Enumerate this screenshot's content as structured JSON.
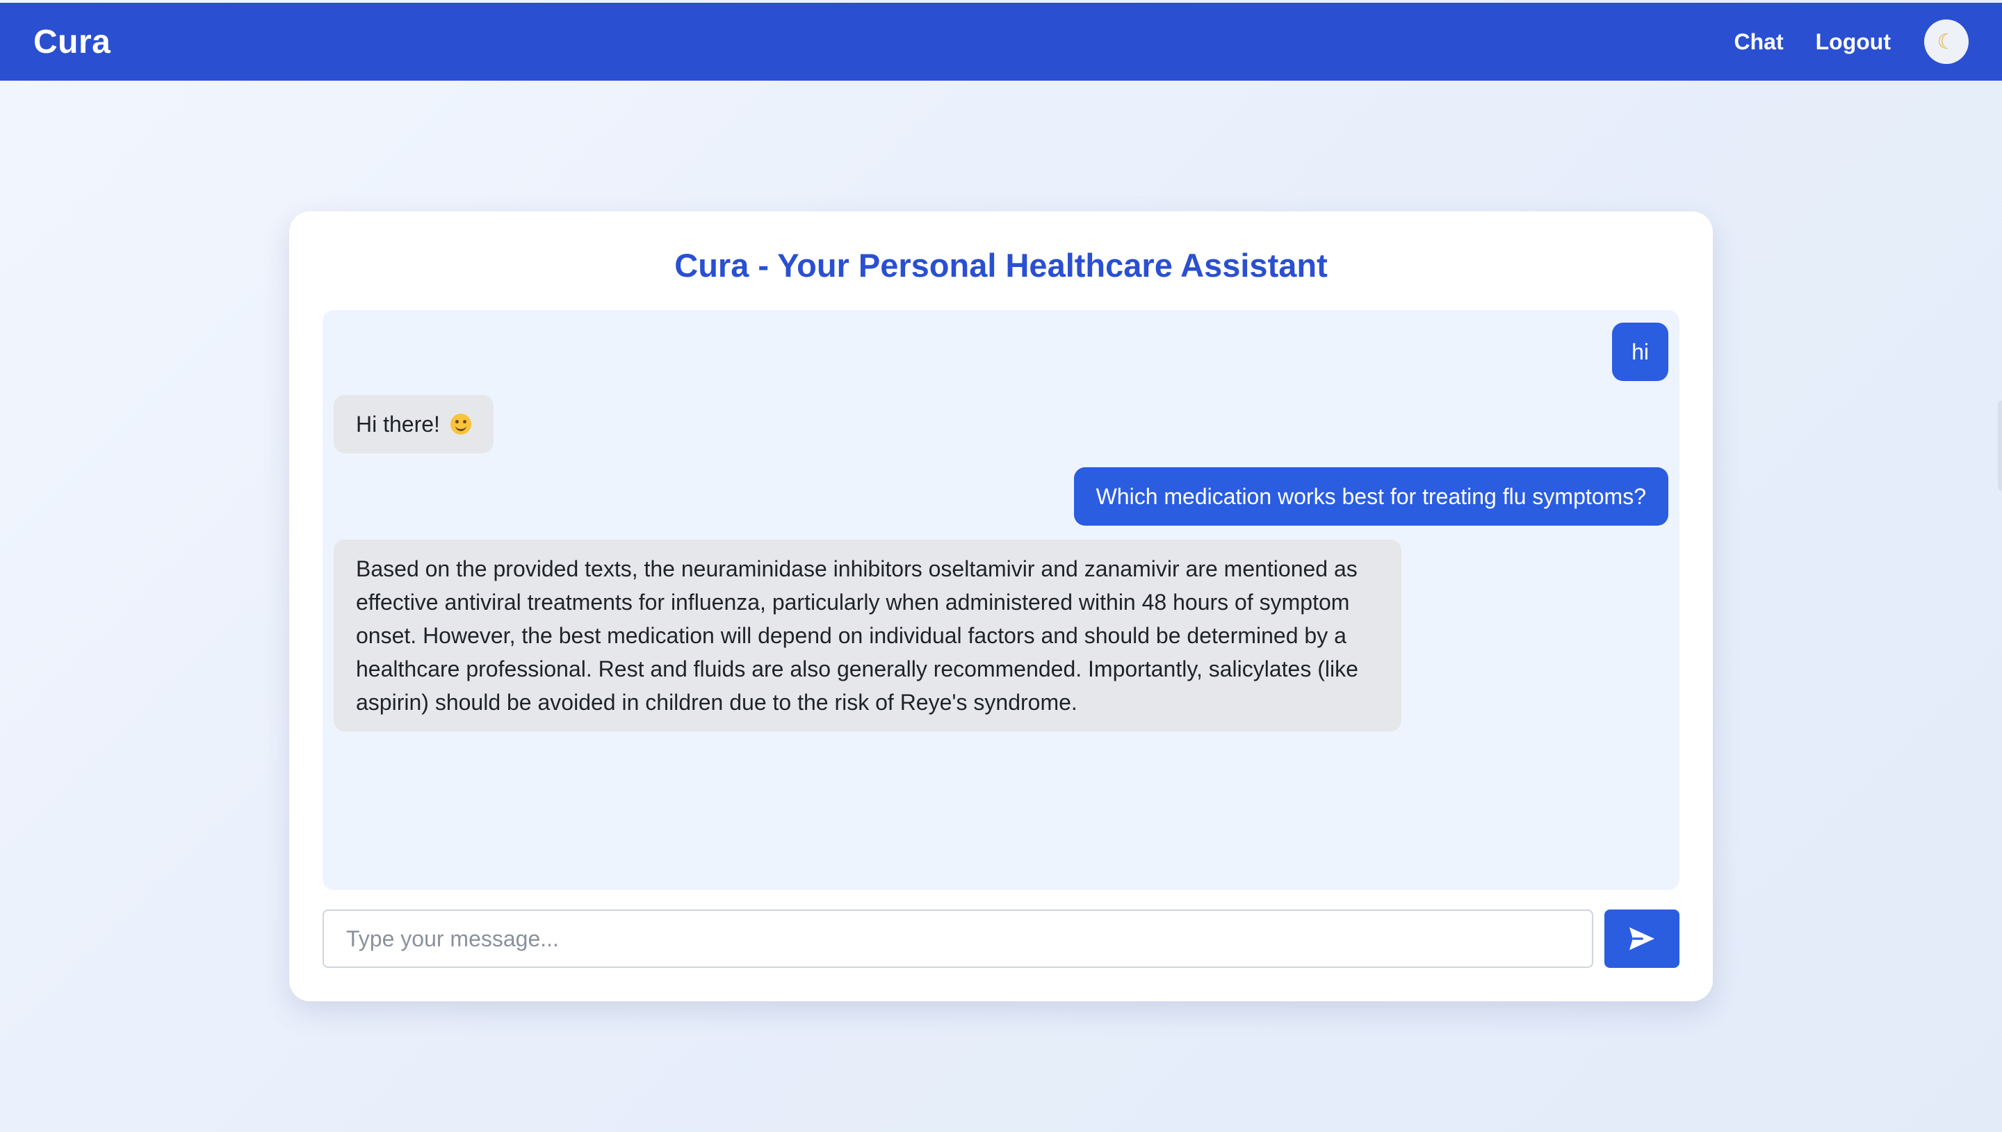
{
  "app": {
    "brand": "Cura"
  },
  "nav": {
    "chat": "Chat",
    "logout": "Logout",
    "theme_icon": "moon-icon"
  },
  "chat": {
    "title": "Cura - Your Personal Healthcare Assistant",
    "messages": [
      {
        "role": "user",
        "text": "hi"
      },
      {
        "role": "assistant",
        "text": "Hi there!",
        "emoji": "smiling-face-icon"
      },
      {
        "role": "user",
        "text": "Which medication works best for treating flu symptoms?"
      },
      {
        "role": "assistant",
        "text": "Based on the provided texts, the neuraminidase inhibitors oseltamivir and zanamivir are mentioned as effective antiviral treatments for influenza, particularly when administered within 48 hours of symptom onset. However, the best medication will depend on individual factors and should be determined by a healthcare professional. Rest and fluids are also generally recommended. Importantly, salicylates (like aspirin) should be avoided in children due to the risk of Reye's syndrome."
      }
    ],
    "input": {
      "value": "",
      "placeholder": "Type your message..."
    },
    "send_icon": "send-icon"
  },
  "colors": {
    "primary": "#2a4fd1",
    "user_bubble": "#2b5de0",
    "bot_bubble": "#e6e7ea",
    "chat_bg": "#eef4fd"
  }
}
